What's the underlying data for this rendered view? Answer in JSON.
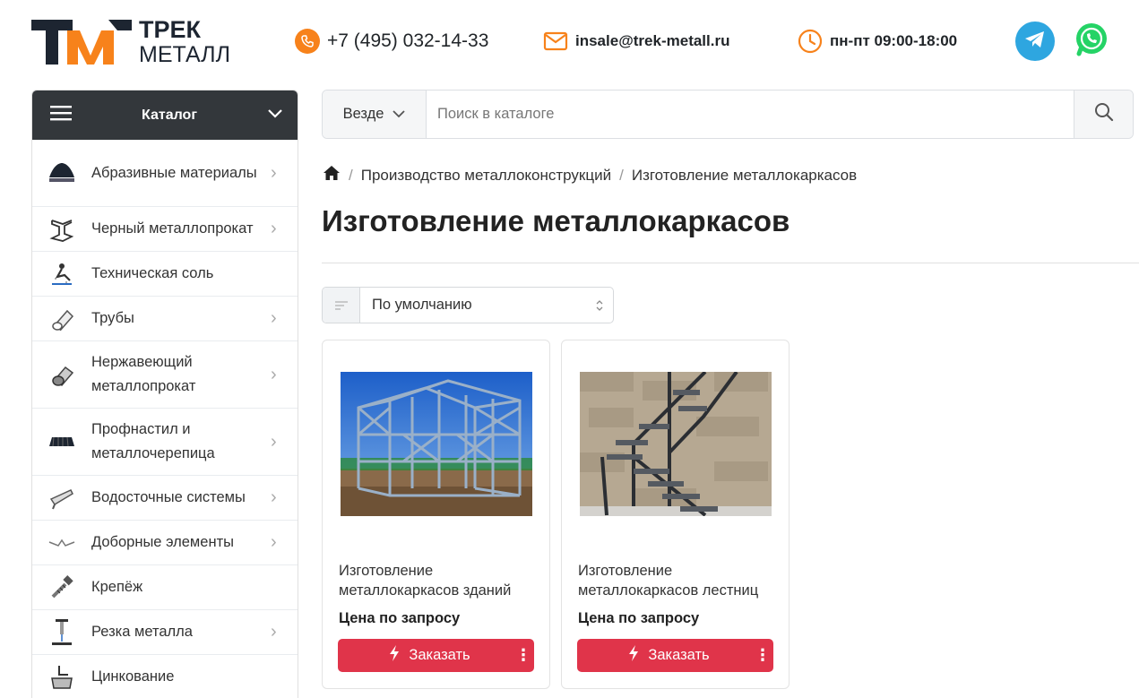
{
  "header": {
    "logo_top": "ТРЕК",
    "logo_bottom": "МЕТАЛЛ",
    "phone": "+7 (495) 032-14-33",
    "email": "insale@trek-metall.ru",
    "hours": "пн-пт 09:00-18:00",
    "accent_color": "#f7821b"
  },
  "catalog": {
    "title": "Каталог",
    "items": [
      {
        "label": "Абразивные материалы",
        "icon": "abrasive-icon",
        "has_children": true
      },
      {
        "label": "Черный металлопрокат",
        "icon": "beam-icon",
        "has_children": true
      },
      {
        "label": "Техническая соль",
        "icon": "salt-icon",
        "has_children": false
      },
      {
        "label": "Трубы",
        "icon": "pipe-icon",
        "has_children": true
      },
      {
        "label": "Нержавеющий металлопрокат",
        "icon": "stainless-icon",
        "has_children": true
      },
      {
        "label": "Профнастил и металлочерепица",
        "icon": "roof-sheet-icon",
        "has_children": true
      },
      {
        "label": "Водосточные системы",
        "icon": "gutter-icon",
        "has_children": true
      },
      {
        "label": "Доборные элементы",
        "icon": "trim-icon",
        "has_children": true
      },
      {
        "label": "Крепёж",
        "icon": "screw-icon",
        "has_children": false
      },
      {
        "label": "Резка металла",
        "icon": "cutting-icon",
        "has_children": true
      },
      {
        "label": "Цинкование",
        "icon": "galvanizing-icon",
        "has_children": false
      }
    ]
  },
  "search": {
    "scope": "Везде",
    "placeholder": "Поиск в каталоге"
  },
  "breadcrumb": {
    "items": [
      "Производство металлоконструкций",
      "Изготовление металлокаркасов"
    ]
  },
  "page": {
    "title": "Изготовление металлокаркасов"
  },
  "sort": {
    "value": "По умолчанию"
  },
  "products": [
    {
      "name": "Изготовление металлокаркасов зданий",
      "price": "Цена по запросу",
      "button": "Заказать"
    },
    {
      "name": "Изготовление металлокаркасов лестниц",
      "price": "Цена по запросу",
      "button": "Заказать"
    }
  ],
  "colors": {
    "order_button": "#e0344a",
    "catalog_header": "#33373b",
    "telegram": "#2ea6e0",
    "whatsapp": "#25d366"
  }
}
